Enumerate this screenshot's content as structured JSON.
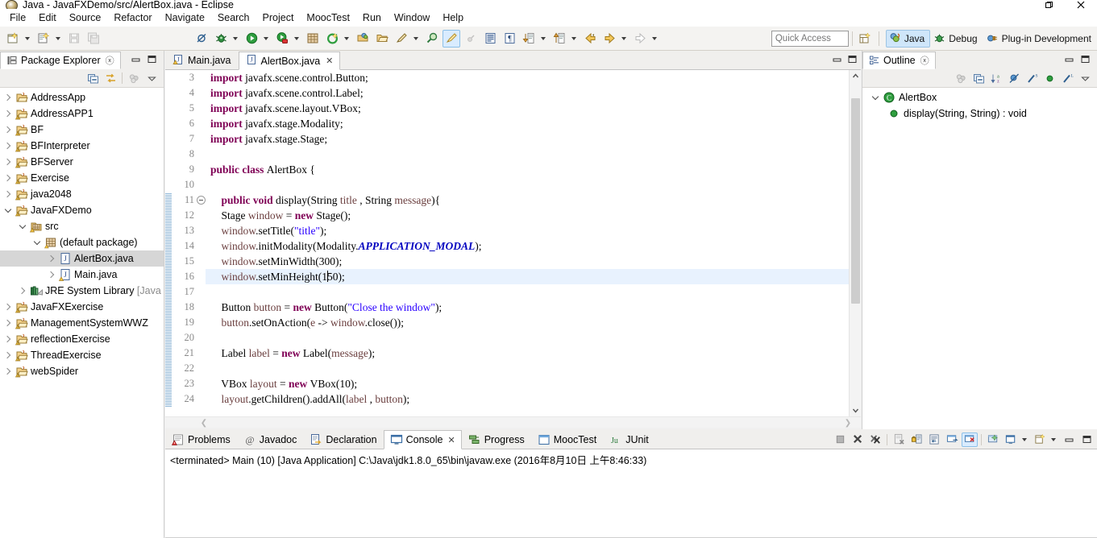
{
  "window": {
    "title": "Java - JavaFXDemo/src/AlertBox.java - Eclipse",
    "controls": {
      "restore": "restore-window",
      "minimize": "minimize-window",
      "close": "close-window"
    }
  },
  "menubar": {
    "items": [
      "File",
      "Edit",
      "Source",
      "Refactor",
      "Navigate",
      "Search",
      "Project",
      "MoocTest",
      "Run",
      "Window",
      "Help"
    ]
  },
  "toolbar": {
    "quick_access_placeholder": "Quick Access",
    "perspectives": [
      {
        "label": "Java",
        "icon": "java-perspective-icon",
        "selected": true
      },
      {
        "label": "Debug",
        "icon": "debug-perspective-icon",
        "selected": false
      },
      {
        "label": "Plug-in Development",
        "icon": "plugin-perspective-icon",
        "selected": false
      }
    ],
    "buttons": [
      "new-wizard-icon",
      "new-java-class-icon",
      "save-icon",
      "save-all-icon",
      "skip-breakpoints-icon",
      "debug-icon",
      "run-icon",
      "run-coverage-icon",
      "new-java-project-icon",
      "external-tools-icon",
      "open-type-icon",
      "open-task-icon",
      "search-icon",
      "annotation-icon",
      "toggle-mark-occurrences-icon",
      "pin-icon",
      "show-whitespace-icon",
      "paragraph-icon",
      "next-annotation-icon",
      "previous-annotation-icon",
      "back-icon",
      "forward-icon"
    ]
  },
  "package_explorer": {
    "tab_label": "Package Explorer",
    "tab_icon": "package-explorer-icon",
    "toolbar": [
      "collapse-all-icon",
      "link-with-editor-icon",
      "view-menu-icon",
      "view-chevron-icon"
    ],
    "tree": [
      {
        "label": "AddressApp",
        "icon": "java-project-icon",
        "state": "collapsed",
        "indent": 0
      },
      {
        "label": "AddressAPP1",
        "icon": "java-project-warning-icon",
        "state": "collapsed",
        "indent": 0
      },
      {
        "label": "BF",
        "icon": "java-project-warning-icon",
        "state": "collapsed",
        "indent": 0
      },
      {
        "label": "BFInterpreter",
        "icon": "java-project-warning-icon",
        "state": "collapsed",
        "indent": 0
      },
      {
        "label": "BFServer",
        "icon": "java-project-warning-icon",
        "state": "collapsed",
        "indent": 0
      },
      {
        "label": "Exercise",
        "icon": "java-project-warning-icon",
        "state": "collapsed",
        "indent": 0
      },
      {
        "label": "java2048",
        "icon": "java-project-warning-icon",
        "state": "collapsed",
        "indent": 0
      },
      {
        "label": "JavaFXDemo",
        "icon": "java-project-warning-icon",
        "state": "expanded",
        "indent": 0
      },
      {
        "label": "src",
        "icon": "source-folder-icon",
        "state": "expanded",
        "indent": 1
      },
      {
        "label": "(default package)",
        "icon": "package-icon",
        "state": "expanded",
        "indent": 2
      },
      {
        "label": "AlertBox.java",
        "icon": "java-file-icon",
        "state": "collapsed",
        "indent": 3,
        "selected": true
      },
      {
        "label": "Main.java",
        "icon": "java-file-warning-icon",
        "state": "collapsed",
        "indent": 3
      },
      {
        "label": "JRE System Library ",
        "label_dim": "[Java",
        "icon": "jre-library-icon",
        "state": "collapsed",
        "indent": 1
      },
      {
        "label": "JavaFXExercise",
        "icon": "java-project-warning-icon",
        "state": "collapsed",
        "indent": 0
      },
      {
        "label": "ManagementSystemWWZ",
        "icon": "java-project-warning-icon",
        "state": "collapsed",
        "indent": 0
      },
      {
        "label": "reflectionExercise",
        "icon": "java-project-warning-icon",
        "state": "collapsed",
        "indent": 0
      },
      {
        "label": "ThreadExercise",
        "icon": "java-project-warning-icon",
        "state": "collapsed",
        "indent": 0
      },
      {
        "label": "webSpider",
        "icon": "java-project-warning-icon",
        "state": "collapsed",
        "indent": 0
      }
    ]
  },
  "editor": {
    "tabs": [
      {
        "label": "Main.java",
        "icon": "java-file-warning-icon",
        "selected": false,
        "closable": false
      },
      {
        "label": "AlertBox.java",
        "icon": "java-file-icon",
        "selected": true,
        "closable": true
      }
    ],
    "close_glyph": "✕",
    "first_visible_line": 3,
    "highlighted_line": 16,
    "change_bar_from_line": 11,
    "fold_marker_line": 11,
    "lines": [
      {
        "n": 3,
        "tokens": [
          {
            "t": "import ",
            "c": "kw"
          },
          {
            "t": "javafx.scene.control.Button;",
            "c": ""
          }
        ]
      },
      {
        "n": 4,
        "tokens": [
          {
            "t": "import ",
            "c": "kw"
          },
          {
            "t": "javafx.scene.control.Label;",
            "c": ""
          }
        ]
      },
      {
        "n": 5,
        "tokens": [
          {
            "t": "import ",
            "c": "kw"
          },
          {
            "t": "javafx.scene.layout.VBox;",
            "c": ""
          }
        ]
      },
      {
        "n": 6,
        "tokens": [
          {
            "t": "import ",
            "c": "kw"
          },
          {
            "t": "javafx.stage.Modality;",
            "c": ""
          }
        ]
      },
      {
        "n": 7,
        "tokens": [
          {
            "t": "import ",
            "c": "kw"
          },
          {
            "t": "javafx.stage.Stage;",
            "c": ""
          }
        ]
      },
      {
        "n": 8,
        "tokens": []
      },
      {
        "n": 9,
        "tokens": [
          {
            "t": "public class ",
            "c": "kw"
          },
          {
            "t": "AlertBox {",
            "c": ""
          }
        ]
      },
      {
        "n": 10,
        "tokens": []
      },
      {
        "n": 11,
        "tokens": [
          {
            "t": "    ",
            "c": ""
          },
          {
            "t": "public void ",
            "c": "kw"
          },
          {
            "t": "display(String ",
            "c": ""
          },
          {
            "t": "title",
            "c": "par"
          },
          {
            "t": " , String ",
            "c": ""
          },
          {
            "t": "message",
            "c": "par"
          },
          {
            "t": "){",
            "c": ""
          }
        ]
      },
      {
        "n": 12,
        "tokens": [
          {
            "t": "    Stage ",
            "c": ""
          },
          {
            "t": "window",
            "c": "par"
          },
          {
            "t": " = ",
            "c": ""
          },
          {
            "t": "new ",
            "c": "kw"
          },
          {
            "t": "Stage();",
            "c": ""
          }
        ]
      },
      {
        "n": 13,
        "tokens": [
          {
            "t": "    ",
            "c": ""
          },
          {
            "t": "window",
            "c": "par"
          },
          {
            "t": ".setTitle(",
            "c": ""
          },
          {
            "t": "\"title\"",
            "c": "str"
          },
          {
            "t": ");",
            "c": ""
          }
        ]
      },
      {
        "n": 14,
        "tokens": [
          {
            "t": "    ",
            "c": ""
          },
          {
            "t": "window",
            "c": "par"
          },
          {
            "t": ".initModality(Modality.",
            "c": ""
          },
          {
            "t": "APPLICATION_MODAL",
            "c": "stat"
          },
          {
            "t": ");",
            "c": ""
          }
        ]
      },
      {
        "n": 15,
        "tokens": [
          {
            "t": "    ",
            "c": ""
          },
          {
            "t": "window",
            "c": "par"
          },
          {
            "t": ".setMinWidth(300);",
            "c": ""
          }
        ]
      },
      {
        "n": 16,
        "tokens": [
          {
            "t": "    ",
            "c": ""
          },
          {
            "t": "window",
            "c": "par"
          },
          {
            "t": ".setMinHeight(1",
            "c": ""
          },
          {
            "t": "|CURSOR|",
            "c": "cursor"
          },
          {
            "t": "50);",
            "c": ""
          }
        ]
      },
      {
        "n": 17,
        "tokens": []
      },
      {
        "n": 18,
        "tokens": [
          {
            "t": "    Button ",
            "c": ""
          },
          {
            "t": "button",
            "c": "par"
          },
          {
            "t": " = ",
            "c": ""
          },
          {
            "t": "new ",
            "c": "kw"
          },
          {
            "t": "Button(",
            "c": ""
          },
          {
            "t": "\"Close the window\"",
            "c": "str"
          },
          {
            "t": ");",
            "c": ""
          }
        ]
      },
      {
        "n": 19,
        "tokens": [
          {
            "t": "    ",
            "c": ""
          },
          {
            "t": "button",
            "c": "par"
          },
          {
            "t": ".setOnAction(",
            "c": ""
          },
          {
            "t": "e",
            "c": "par"
          },
          {
            "t": " -> ",
            "c": ""
          },
          {
            "t": "window",
            "c": "par"
          },
          {
            "t": ".close());",
            "c": ""
          }
        ]
      },
      {
        "n": 20,
        "tokens": []
      },
      {
        "n": 21,
        "tokens": [
          {
            "t": "    Label ",
            "c": ""
          },
          {
            "t": "label",
            "c": "par"
          },
          {
            "t": " = ",
            "c": ""
          },
          {
            "t": "new ",
            "c": "kw"
          },
          {
            "t": "Label(",
            "c": ""
          },
          {
            "t": "message",
            "c": "par"
          },
          {
            "t": ");",
            "c": ""
          }
        ]
      },
      {
        "n": 22,
        "tokens": []
      },
      {
        "n": 23,
        "tokens": [
          {
            "t": "    VBox ",
            "c": ""
          },
          {
            "t": "layout",
            "c": "par"
          },
          {
            "t": " = ",
            "c": ""
          },
          {
            "t": "new ",
            "c": "kw"
          },
          {
            "t": "VBox(10);",
            "c": ""
          }
        ]
      },
      {
        "n": 24,
        "tokens": [
          {
            "t": "    ",
            "c": ""
          },
          {
            "t": "layout",
            "c": "par"
          },
          {
            "t": ".getChildren().addAll(",
            "c": ""
          },
          {
            "t": "label",
            "c": "par"
          },
          {
            "t": " , ",
            "c": ""
          },
          {
            "t": "button",
            "c": "par"
          },
          {
            "t": ");",
            "c": ""
          }
        ]
      }
    ]
  },
  "outline": {
    "tab_label": "Outline",
    "tab_icon": "outline-icon",
    "toolbar": [
      "focus-icon",
      "collapse-all-icon",
      "sort-icon",
      "hide-fields-icon",
      "hide-static-icon",
      "hide-nonpublic-icon",
      "hide-local-icon",
      "view-chevron-icon"
    ],
    "tree": [
      {
        "label": "AlertBox",
        "icon": "class-icon",
        "state": "expanded",
        "indent": 0
      },
      {
        "label": "display(String, String) : void",
        "icon": "public-method-icon",
        "state": "leaf",
        "indent": 1,
        "selected": true
      }
    ]
  },
  "console": {
    "tabs": [
      {
        "label": "Problems",
        "icon": "problems-icon",
        "selected": false
      },
      {
        "label": "Javadoc",
        "icon": "javadoc-icon",
        "selected": false
      },
      {
        "label": "Declaration",
        "icon": "declaration-icon",
        "selected": false
      },
      {
        "label": "Console",
        "icon": "console-icon",
        "selected": true,
        "closable": true
      },
      {
        "label": "Progress",
        "icon": "progress-icon",
        "selected": false
      },
      {
        "label": "MoocTest",
        "icon": "mooctest-icon",
        "selected": false
      },
      {
        "label": "JUnit",
        "icon": "junit-icon",
        "selected": false
      }
    ],
    "close_glyph": "✕",
    "toolbar": [
      "terminate-icon",
      "remove-launch-icon",
      "remove-all-launches-icon",
      "clear-console-icon",
      "scroll-lock-icon",
      "word-wrap-icon",
      "show-console-on-output-icon",
      "pin-console-icon",
      "display-selected-console-icon",
      "open-console-icon",
      "minimize-icon",
      "maximize-icon"
    ],
    "output": "<terminated> Main (10) [Java Application] C:\\Java\\jdk1.8.0_65\\bin\\javaw.exe (2016年8月10日 上午8:46:33)"
  },
  "colors": {
    "keyword": "#7f0055",
    "string": "#2a00ff",
    "static_field": "#0000c0",
    "parameter": "#6a3e3e",
    "line_number": "#8a8a8a",
    "current_line_highlight": "#e8f2fe",
    "selection_inactive": "#d6d6d6",
    "perspective_selected": "#cfe6fa",
    "toolbar_bg": "#f4f3f1",
    "panel_bg": "#f0efed"
  }
}
